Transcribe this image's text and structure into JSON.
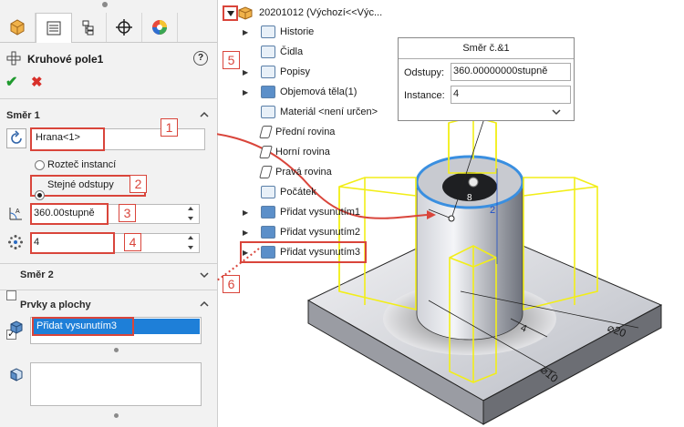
{
  "panel": {
    "title": "Kruhové pole1",
    "help": "?",
    "ok": "✔",
    "cancel": "✖",
    "tabs": [
      "feature-manager-icon",
      "property-manager-icon",
      "configuration-manager-icon",
      "dimxpert-icon",
      "display-manager-icon"
    ],
    "direction1": {
      "title": "Směr 1",
      "axis_value": "Hrana<1>",
      "radio_instance_spacing": "Rozteč instancí",
      "radio_equal_spacing": "Stejné odstupy",
      "angle_value": "360.00stupně",
      "count_value": "4"
    },
    "direction2": {
      "title": "Směr 2"
    },
    "features": {
      "title": "Prvky a plochy",
      "selected_item": "Přidat vysunutím3"
    }
  },
  "callouts": [
    "1",
    "2",
    "3",
    "4",
    "5",
    "6"
  ],
  "tree": {
    "root": "20201012  (Výchozí<<Výc...",
    "items": [
      {
        "label": "Historie",
        "expand": "▶"
      },
      {
        "label": "Čidla",
        "expand": ""
      },
      {
        "label": "Popisy",
        "expand": "▶"
      },
      {
        "label": "Objemová těla(1)",
        "expand": "▶"
      },
      {
        "label": "Materiál <není určen>",
        "expand": ""
      },
      {
        "label": "Přední rovina",
        "expand": ""
      },
      {
        "label": "Horní rovina",
        "expand": ""
      },
      {
        "label": "Pravá rovina",
        "expand": ""
      },
      {
        "label": "Počátek",
        "expand": ""
      },
      {
        "label": "Přidat vysunutím1",
        "expand": "▶"
      },
      {
        "label": "Přidat vysunutím2",
        "expand": "▶"
      },
      {
        "label": "Přidat vysunutím3",
        "expand": "▶"
      }
    ]
  },
  "popup": {
    "title": "Směr č.&1",
    "spacing_label": "Odstupy:",
    "spacing_value": "360.00000000stupně",
    "instances_label": "Instance:",
    "instances_value": "4"
  },
  "viewport": {
    "dim_4": "4",
    "dim_20": "⌀20",
    "dim_10": "⌀10",
    "dim_2": "2",
    "dim_8": "8"
  },
  "colors": {
    "callout_red": "#d9453b",
    "selection_blue": "#1e7fd8",
    "preview_yellow": "#f2ee18",
    "edge_highlight": "#3a8fe0"
  }
}
